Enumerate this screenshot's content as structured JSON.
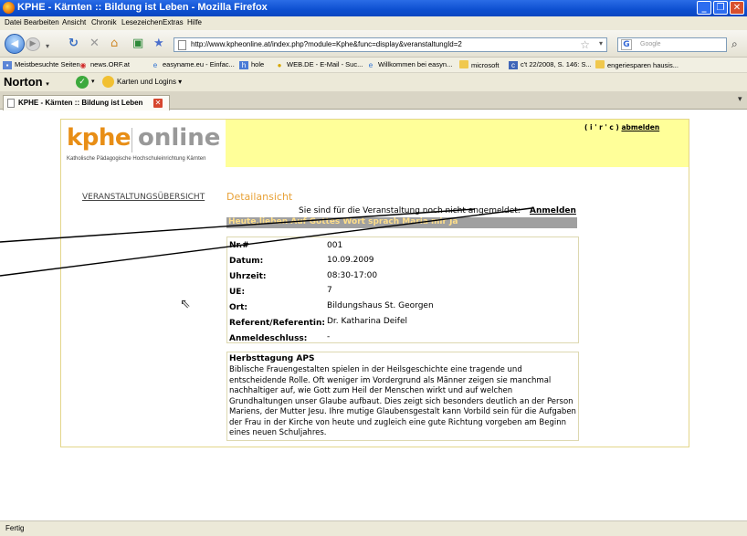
{
  "window": {
    "title": "KPHE - Kärnten :: Bildung ist Leben - Mozilla Firefox",
    "buttons": [
      "_",
      "❐",
      "✕"
    ]
  },
  "menu": [
    "Datei",
    "Bearbeiten",
    "Ansicht",
    "Chronik",
    "Lesezeichen",
    "Extras",
    "Hilfe"
  ],
  "nav": {
    "url": "http://www.kpheonline.at/index.php?module=Kphe&func=display&veranstaltungId=2",
    "search_placeholder": "Google"
  },
  "bookmarks": [
    {
      "label": "Meistbesuchte Seiten",
      "icon": "chart-icon"
    },
    {
      "label": "news.ORF.at",
      "icon": "orf-icon"
    },
    {
      "label": "easyname.eu - Einfac...",
      "icon": "ie-icon"
    },
    {
      "label": "hole",
      "icon": "hole-icon"
    },
    {
      "label": "WEB.DE - E-Mail - Suc...",
      "icon": "webde-icon"
    },
    {
      "label": "Willkommen bei easyn...",
      "icon": "ie-icon"
    },
    {
      "label": "microsoft",
      "icon": "folder-icon"
    },
    {
      "label": "c't 22/2008, S. 146: S...",
      "icon": "ct-icon"
    },
    {
      "label": "engeriesparen hausis...",
      "icon": "folder-icon"
    }
  ],
  "toolbar2": {
    "norton": "Norton",
    "karten": "Karten und Logins"
  },
  "tab": {
    "title": "KPHE - Kärnten :: Bildung ist Leben"
  },
  "page": {
    "logo_kphe": "kphe",
    "logo_online": "online",
    "logo_subtitle": "Katholische Pädagogische Hochschuleinrichtung Kärnten",
    "user_prefix": "( i ' r ' c )",
    "logout": "abmelden",
    "nav_overview": "VERANSTALTUNGSÜBERSICHT",
    "detail_title": "Detailansicht",
    "notice": "Sie sind für die Veranstaltung noch nicht angemeldet:",
    "register": "Anmelden",
    "event_title": "Heute,lieben Auf Gottes Wort sprach Maria mir Ja",
    "details": [
      {
        "label": "Nr.#",
        "value": "001"
      },
      {
        "label": "Datum:",
        "value": "10.09.2009"
      },
      {
        "label": "Uhrzeit:",
        "value": "08:30-17:00"
      },
      {
        "label": "UE:",
        "value": "7"
      },
      {
        "label": "Ort:",
        "value": "Bildungshaus St. Georgen"
      },
      {
        "label": "Referent/Referentin:",
        "value": "Dr. Katharina Deifel"
      },
      {
        "label": "Anmeldeschluss:",
        "value": "-"
      }
    ],
    "desc_title": "Herbsttagung APS",
    "desc_text": "Biblische Frauengestalten spielen in der Heilsgeschichte eine tragende und entscheidende Rolle. Oft weniger im Vordergrund als Männer zeigen sie manchmal nachhaltiger auf, wie Gott zum Heil der Menschen wirkt und auf welchen Grundhaltungen unser Glaube aufbaut. Dies zeigt sich besonders deutlich an der Person Mariens, der Mutter Jesu. Ihre mutige Glaubensgestalt kann Vorbild sein für die Aufgaben der Frau in der Kirche von heute und zugleich eine gute Richtung vorgeben am Beginn eines neuen Schuljahres."
  },
  "status": "Fertig"
}
